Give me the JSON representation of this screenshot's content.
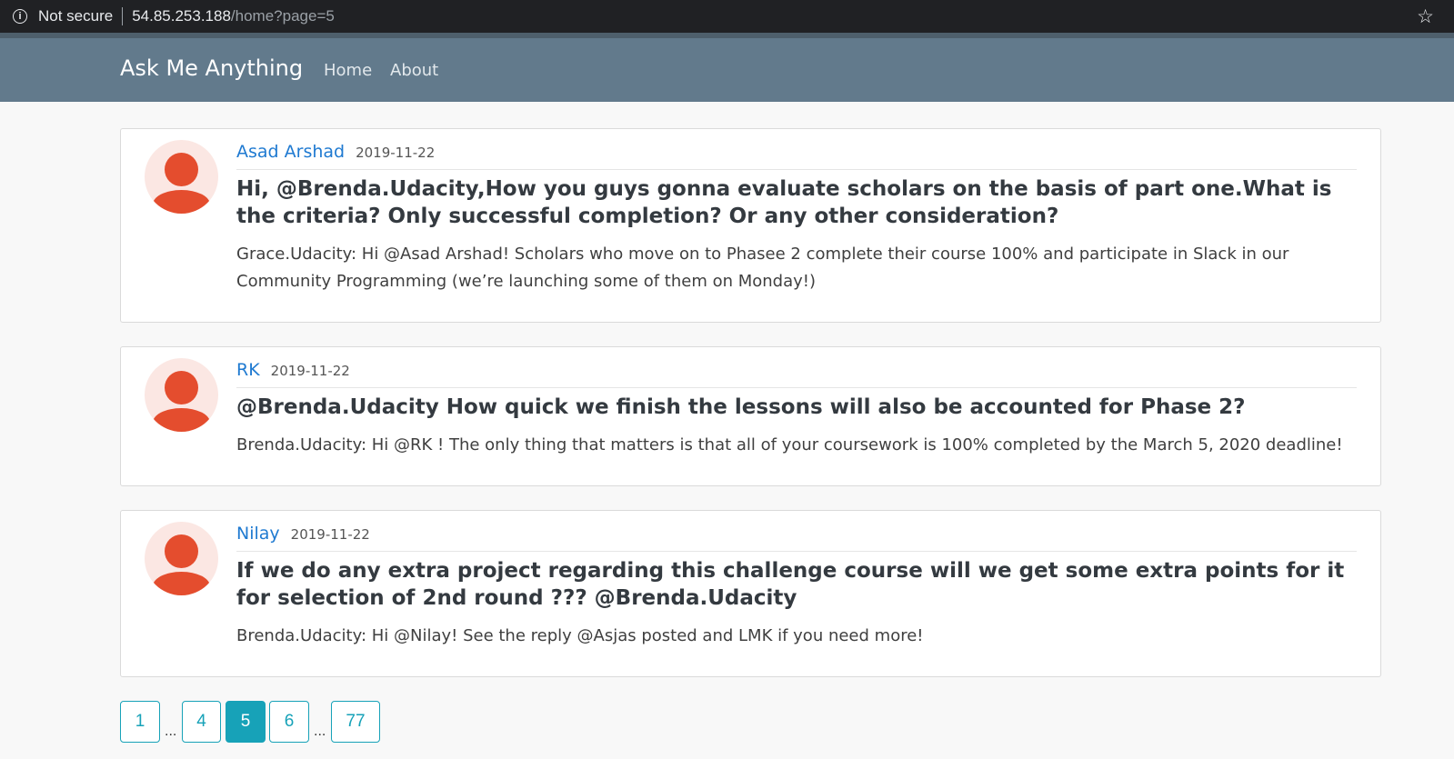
{
  "browser": {
    "security_label": "Not secure",
    "url_host": "54.85.253.188",
    "url_path": "/home?page=5"
  },
  "navbar": {
    "brand": "Ask Me Anything",
    "links": [
      "Home",
      "About"
    ]
  },
  "posts": [
    {
      "author": "Asad Arshad",
      "date": "2019-11-22",
      "question": "Hi, @Brenda.Udacity,How you guys gonna evaluate scholars on the basis of part one.What is the criteria? Only successful completion? Or any other consideration?",
      "answer": "Grace.Udacity: Hi @Asad Arshad! Scholars who move on to Phasee 2 complete their course 100% and participate in Slack in our Community Programming (we’re launching some of them on Monday!)"
    },
    {
      "author": "RK",
      "date": "2019-11-22",
      "question": "@Brenda.Udacity How quick we finish the lessons will also be accounted for Phase 2?",
      "answer": "Brenda.Udacity: Hi @RK ! The only thing that matters is that all of your coursework is 100% completed by the March 5, 2020 deadline!"
    },
    {
      "author": "Nilay",
      "date": "2019-11-22",
      "question": "If we do any extra project regarding this challenge course will we get some extra points for it for selection of 2nd round ??? @Brenda.Udacity",
      "answer": "Brenda.Udacity: Hi @Nilay! See the reply @Asjas posted and LMK if you need more!"
    }
  ],
  "pagination": {
    "pages": [
      "1",
      "4",
      "5",
      "6",
      "77"
    ],
    "current": "5",
    "ellipsis": "..."
  },
  "colors": {
    "navbar": "#627a8c",
    "accent": "#17a2b8",
    "author_link": "#1f7ad1",
    "avatar": "#e44d2e"
  },
  "icons": [
    "info-icon",
    "star-icon",
    "user-avatar-icon"
  ]
}
